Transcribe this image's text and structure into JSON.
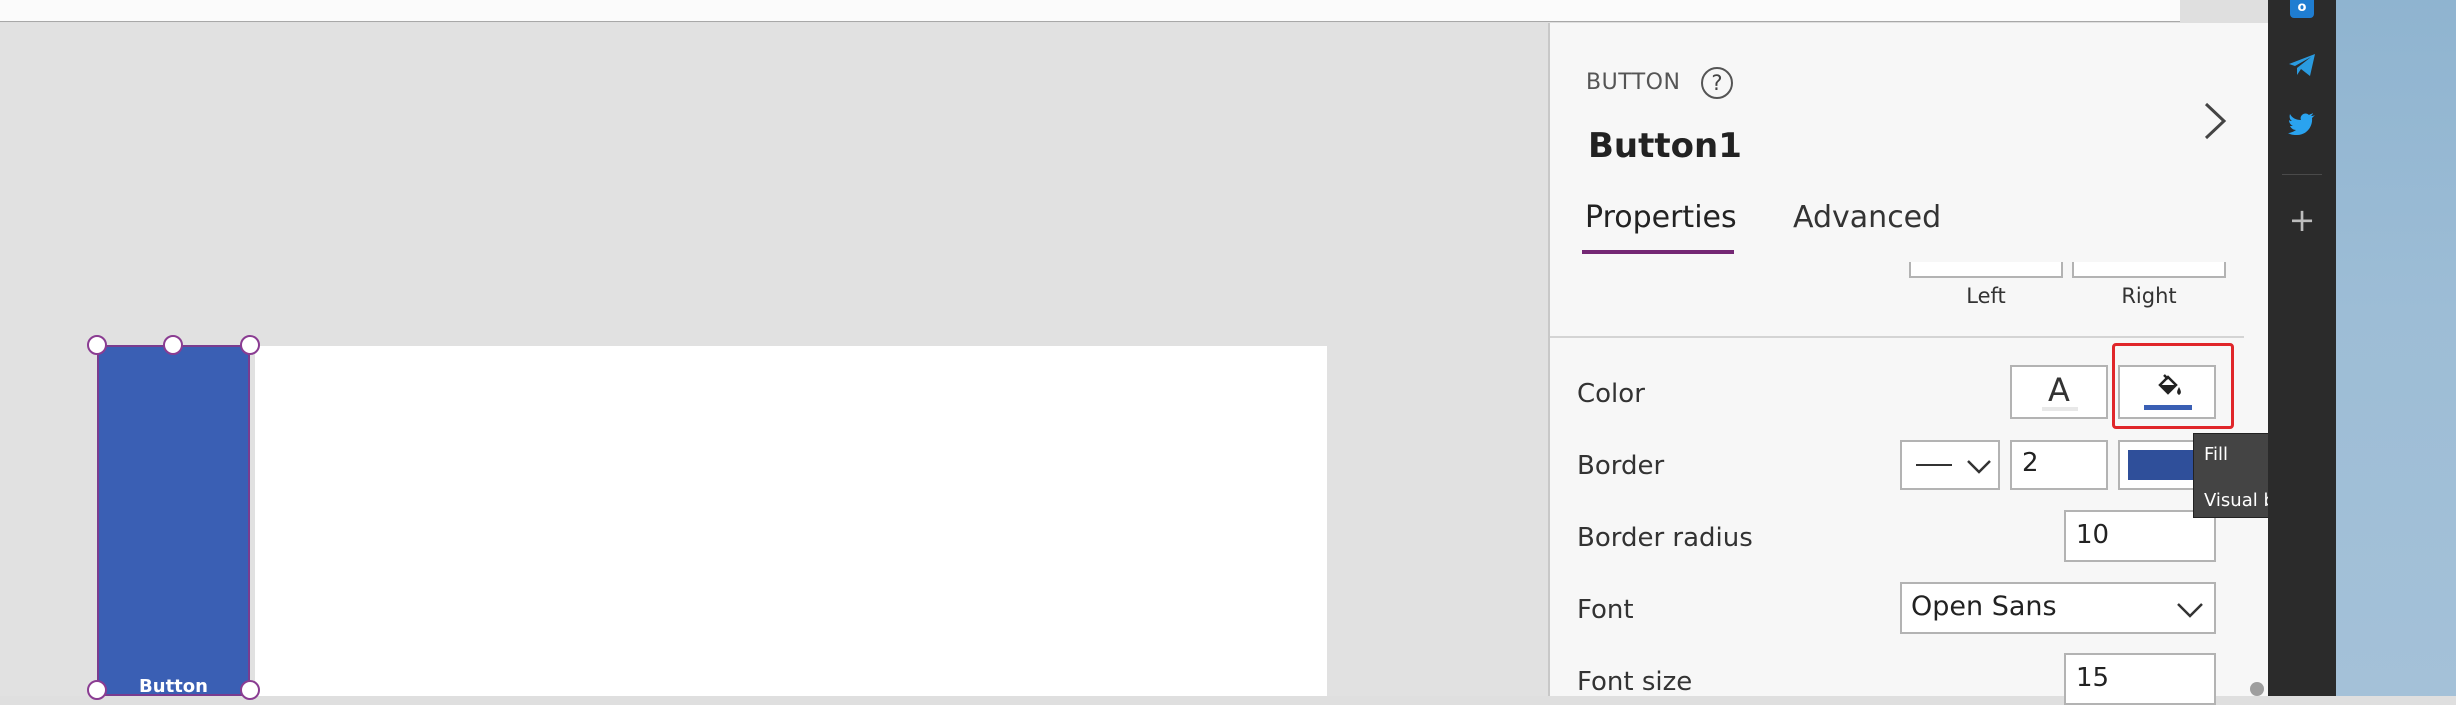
{
  "panel": {
    "control_type": "BUTTON",
    "help_glyph": "?",
    "control_name": "Button1",
    "collapse_glyph": "›",
    "tabs": [
      {
        "label": "Properties",
        "active": true
      },
      {
        "label": "Advanced",
        "active": false
      }
    ],
    "padding": {
      "left_label": "Left",
      "right_label": "Right"
    },
    "properties": {
      "color_label": "Color",
      "color_text_glyph": "A",
      "border_label": "Border",
      "border_width": "2",
      "border_radius_label": "Border radius",
      "border_radius": "10",
      "font_label": "Font",
      "font_value": "Open Sans",
      "font_size_label": "Font size",
      "font_size": "15"
    }
  },
  "canvas": {
    "button_label": "Button"
  },
  "tooltip": {
    "title": "Fill",
    "description": "Visual background color."
  },
  "appbar": {
    "outlook_glyph": "o",
    "add_glyph": "+"
  },
  "colors": {
    "button_fill": "#3a5fb4",
    "border_color": "#2f4f9a",
    "accent": "#742774",
    "highlight": "#e0262a"
  },
  "icons": [
    "help-icon",
    "chevron-right-icon",
    "fill-bucket-icon",
    "chevron-down-icon",
    "outlook-icon",
    "telegram-icon",
    "twitter-icon",
    "plus-icon"
  ]
}
